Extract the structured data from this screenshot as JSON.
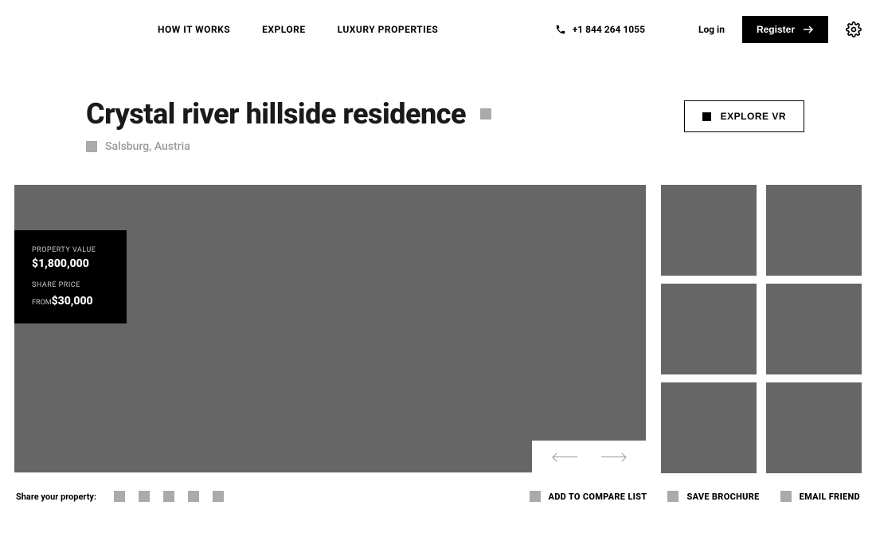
{
  "header": {
    "nav": [
      "HOW IT WORKS",
      "EXPLORE",
      "LUXURY PROPERTIES"
    ],
    "phone": "+1 844 264 1055",
    "login": "Log in",
    "register": "Register"
  },
  "property": {
    "title": "Crystal river hillside residence",
    "location": "Salsburg, Austria",
    "explore_vr": "EXPLORE VR",
    "value_label": "PROPERTY VALUE",
    "value": "$1,800,000",
    "share_label": "SHARE PRICE",
    "from": "FROM",
    "share_value": "$30,000"
  },
  "bottom": {
    "share_label": "Share your property:",
    "compare": "ADD TO COMPARE LIST",
    "brochure": "SAVE BROCHURE",
    "email": "EMAIL FRIEND"
  }
}
